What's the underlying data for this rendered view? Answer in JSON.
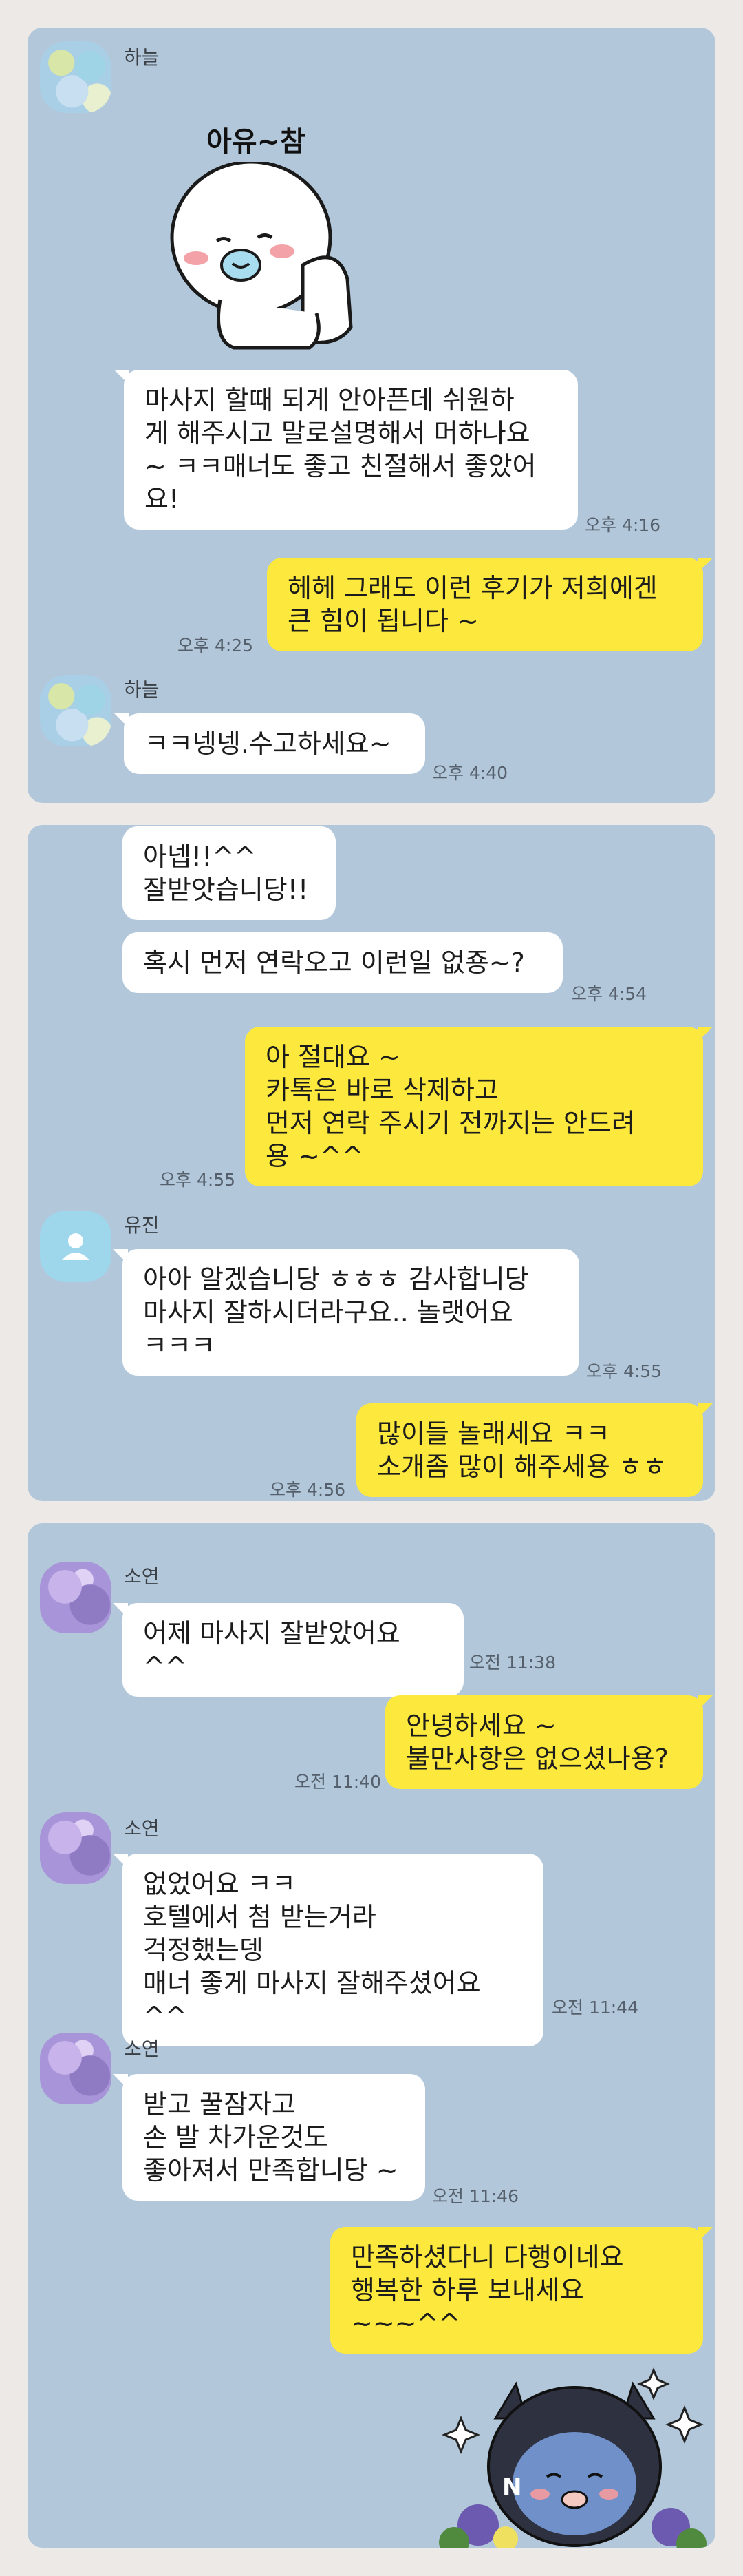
{
  "card1": {
    "sender1": "하늘",
    "sticker_text": "아유~참",
    "msg1": "마사지 할때 되게 안아픈데 쉬원하\n게 해주시고 말로설명해서 머하나요\n~ ㅋㅋ매너도 좋고 친절해서 좋았어\n요!",
    "time1": "오후 4:16",
    "reply1": "헤헤 그래도 이런 후기가 저희에겐\n큰 힘이 됩니다 ~",
    "reply1_time": "오후 4:25",
    "sender2": "하늘",
    "msg2": "ㅋㅋ넹넹.수고하세요~",
    "time2": "오후 4:40"
  },
  "card2": {
    "msg1": "아넵!!^^\n잘받앗습니당!!",
    "msg2": "혹시 먼저 연락오고 이런일 없죵~?",
    "time2": "오후 4:54",
    "reply1": "아 절대요 ~\n카톡은 바로 삭제하고\n먼저 연락 주시기 전까지는 안드려\n용 ~^^",
    "reply1_time": "오후 4:55",
    "sender": "유진",
    "msg3": "아아 알겠습니당 ㅎㅎㅎ 감사합니당\n마사지 잘하시더라구요.. 놀랫어요\nㅋㅋㅋ",
    "time3": "오후 4:55",
    "reply2": "많이들 놀래세요 ㅋㅋ\n소개좀 많이 해주세용 ㅎㅎ",
    "reply2_time": "오후 4:56"
  },
  "card3": {
    "sender1": "소연",
    "msg1": "어제 마사지 잘받았어요 ^^",
    "time1": "오전 11:38",
    "reply1": "안녕하세요 ~\n불만사항은 없으셨나용?",
    "reply1_time": "오전 11:40",
    "sender2": "소연",
    "msg2": "없었어요 ㅋㅋ\n호텔에서 첨 받는거라\n걱정했는뎅\n매너 좋게 마사지 잘해주셨어요 ^^",
    "time2": "오전 11:44",
    "sender3": "소연",
    "msg3": "받고 꿀잠자고\n손 발 차가운것도\n좋아져서 만족합니당 ~",
    "time3": "오전 11:46",
    "reply2": "만족하셨다니 다행이네요\n행복한 하루 보내세요 ~~~^^",
    "sticker2_letter": "N"
  },
  "colors": {
    "background": "#b2c7da",
    "outgoing": "#fde93d",
    "incoming": "#ffffff",
    "page": "#ece9e6"
  }
}
